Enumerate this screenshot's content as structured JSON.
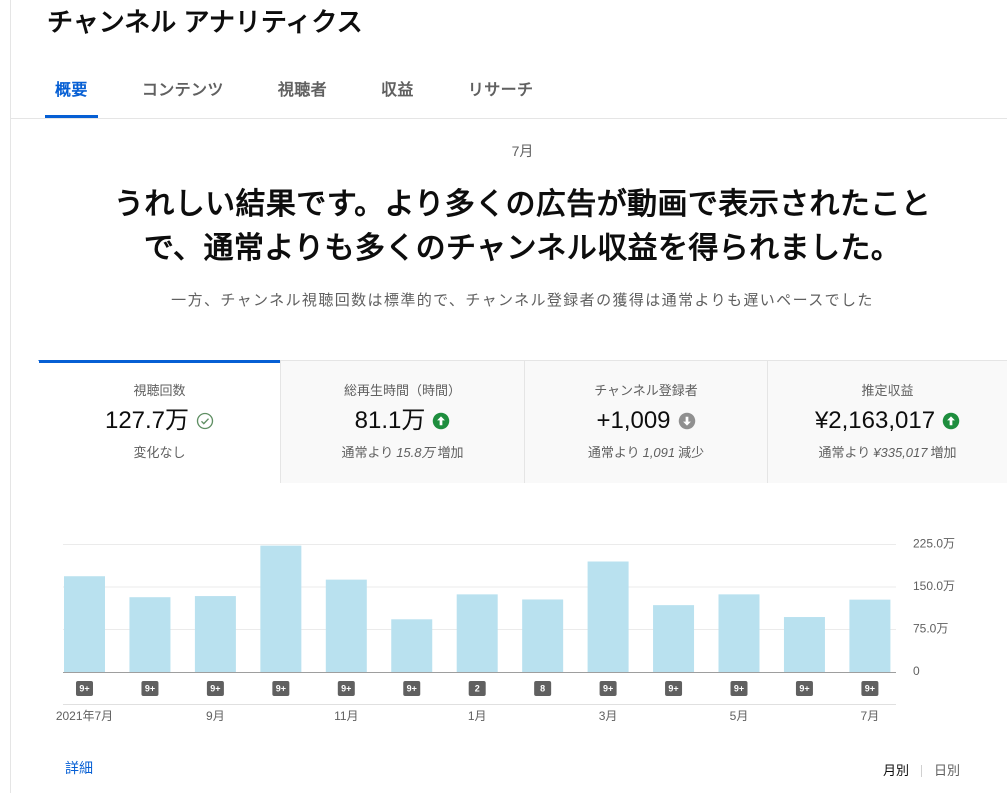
{
  "header": {
    "title": "チャンネル アナリティクス"
  },
  "tabs": [
    {
      "label": "概要",
      "active": true
    },
    {
      "label": "コンテンツ",
      "active": false
    },
    {
      "label": "視聴者",
      "active": false
    },
    {
      "label": "収益",
      "active": false
    },
    {
      "label": "リサーチ",
      "active": false
    }
  ],
  "summary": {
    "period": "7月",
    "headline_lines": [
      "うれしい結果です。より多くの広告が動画で表示されたこと",
      "で、通常よりも多くのチャンネル収益を得られました。"
    ],
    "subtext": "一方、チャンネル視聴回数は標準的で、チャンネル登録者の獲得は通常よりも遅いペースでした"
  },
  "metrics": [
    {
      "label": "視聴回数",
      "value": "127.7万",
      "icon": "check-circle-outline-icon",
      "status_color": "#5f8f63",
      "note": "変化なし",
      "selected": true
    },
    {
      "label": "総再生時間（時間）",
      "value": "81.1万",
      "icon": "arrow-up-circle-icon",
      "status_color": "#1e8e3e",
      "note_prefix": "通常より",
      "note_value": "15.8万",
      "note_suffix": "増加",
      "selected": false
    },
    {
      "label": "チャンネル登録者",
      "value": "+1,009",
      "icon": "arrow-down-circle-icon",
      "status_color": "#909090",
      "note_prefix": "通常より",
      "note_value": "1,091",
      "note_suffix": "減少",
      "selected": false
    },
    {
      "label": "推定収益",
      "value": "¥2,163,017",
      "icon": "arrow-up-circle-icon",
      "status_color": "#1e8e3e",
      "note_prefix": "通常より",
      "note_value": "¥335,017",
      "note_suffix": "増加",
      "selected": false
    }
  ],
  "chart_data": {
    "type": "bar",
    "categories": [
      "2021年7月",
      "",
      "9月",
      "",
      "11月",
      "",
      "1月",
      "",
      "3月",
      "",
      "5月",
      "",
      "7月"
    ],
    "values": [
      169,
      132,
      134,
      223,
      163,
      93,
      137,
      128,
      195,
      118,
      137,
      97,
      127.7
    ],
    "ylim": [
      0,
      225
    ],
    "y_ticks": [
      0,
      75,
      150,
      225
    ],
    "y_tick_labels": [
      "0",
      "75.0万",
      "150.0万",
      "225.0万"
    ],
    "badges": [
      "9+",
      "9+",
      "9+",
      "9+",
      "9+",
      "9+",
      "2",
      "8",
      "9+",
      "9+",
      "9+",
      "9+",
      "9+"
    ],
    "bar_color": "#b9e1ef",
    "grid": true
  },
  "footer": {
    "details_link": "詳細",
    "monthly": "月別",
    "daily": "日別"
  },
  "colors": {
    "accent": "#065fd4"
  }
}
